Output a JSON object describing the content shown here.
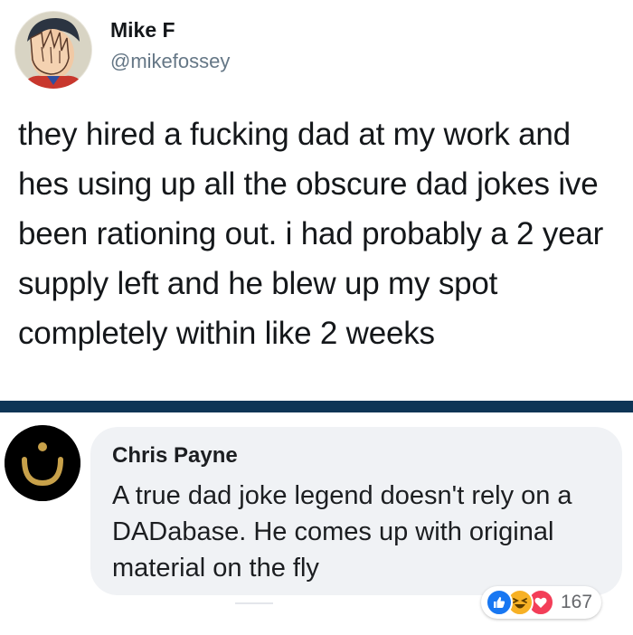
{
  "tweet": {
    "author_name": "Mike F",
    "author_handle": "@mikefossey",
    "text": "they hired a fucking dad at my work and hes using up all the obscure dad jokes ive been rationing out. i had probably a 2 year supply left and he blew up my spot completely within like 2 weeks",
    "avatar_icon": "facepalm-comic-avatar"
  },
  "comment": {
    "author_name": "Chris Payne",
    "text": "A true dad joke legend doesn't rely on a DADabase. He comes up with original material on the fly",
    "avatar_icon": "arabic-nun-symbol-avatar",
    "reactions": {
      "types": [
        "like",
        "haha",
        "love"
      ],
      "count": "167"
    }
  },
  "colors": {
    "divider": "#0e3556",
    "handle": "#657786",
    "bubble": "#f0f2f5",
    "like": "#1877f2",
    "haha": "#f7b125",
    "love": "#f33e58"
  }
}
